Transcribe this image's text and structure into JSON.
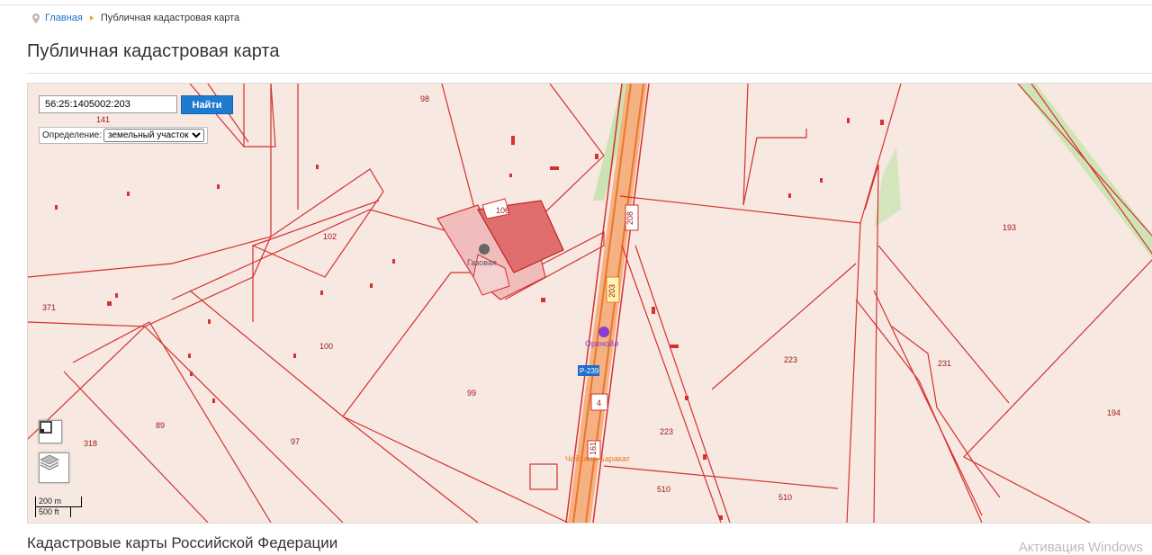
{
  "breadcrumb": {
    "home": "Главная",
    "current": "Публичная кадастровая карта"
  },
  "page": {
    "title": "Публичная кадастровая карта",
    "footer_title": "Кадастровые карты Российской Федерации",
    "watermark": "Активация Windows"
  },
  "search": {
    "value": "56:25:1405002:203",
    "button": "Найти"
  },
  "definition": {
    "label": "Определение:",
    "selected": "земельный участок"
  },
  "scale": {
    "metric": "200 m",
    "imperial": "500 ft"
  },
  "map": {
    "parcel_labels": [
      "98",
      "106",
      "141",
      "102",
      "371",
      "100",
      "99",
      "89",
      "318",
      "97",
      "193",
      "208",
      "203",
      "223",
      "231",
      "194",
      "510",
      "4",
      "161"
    ],
    "road_labels": [
      "Р-239"
    ],
    "places": [
      "Газовая",
      "Оренойл",
      "Чайхана Баракат"
    ]
  }
}
